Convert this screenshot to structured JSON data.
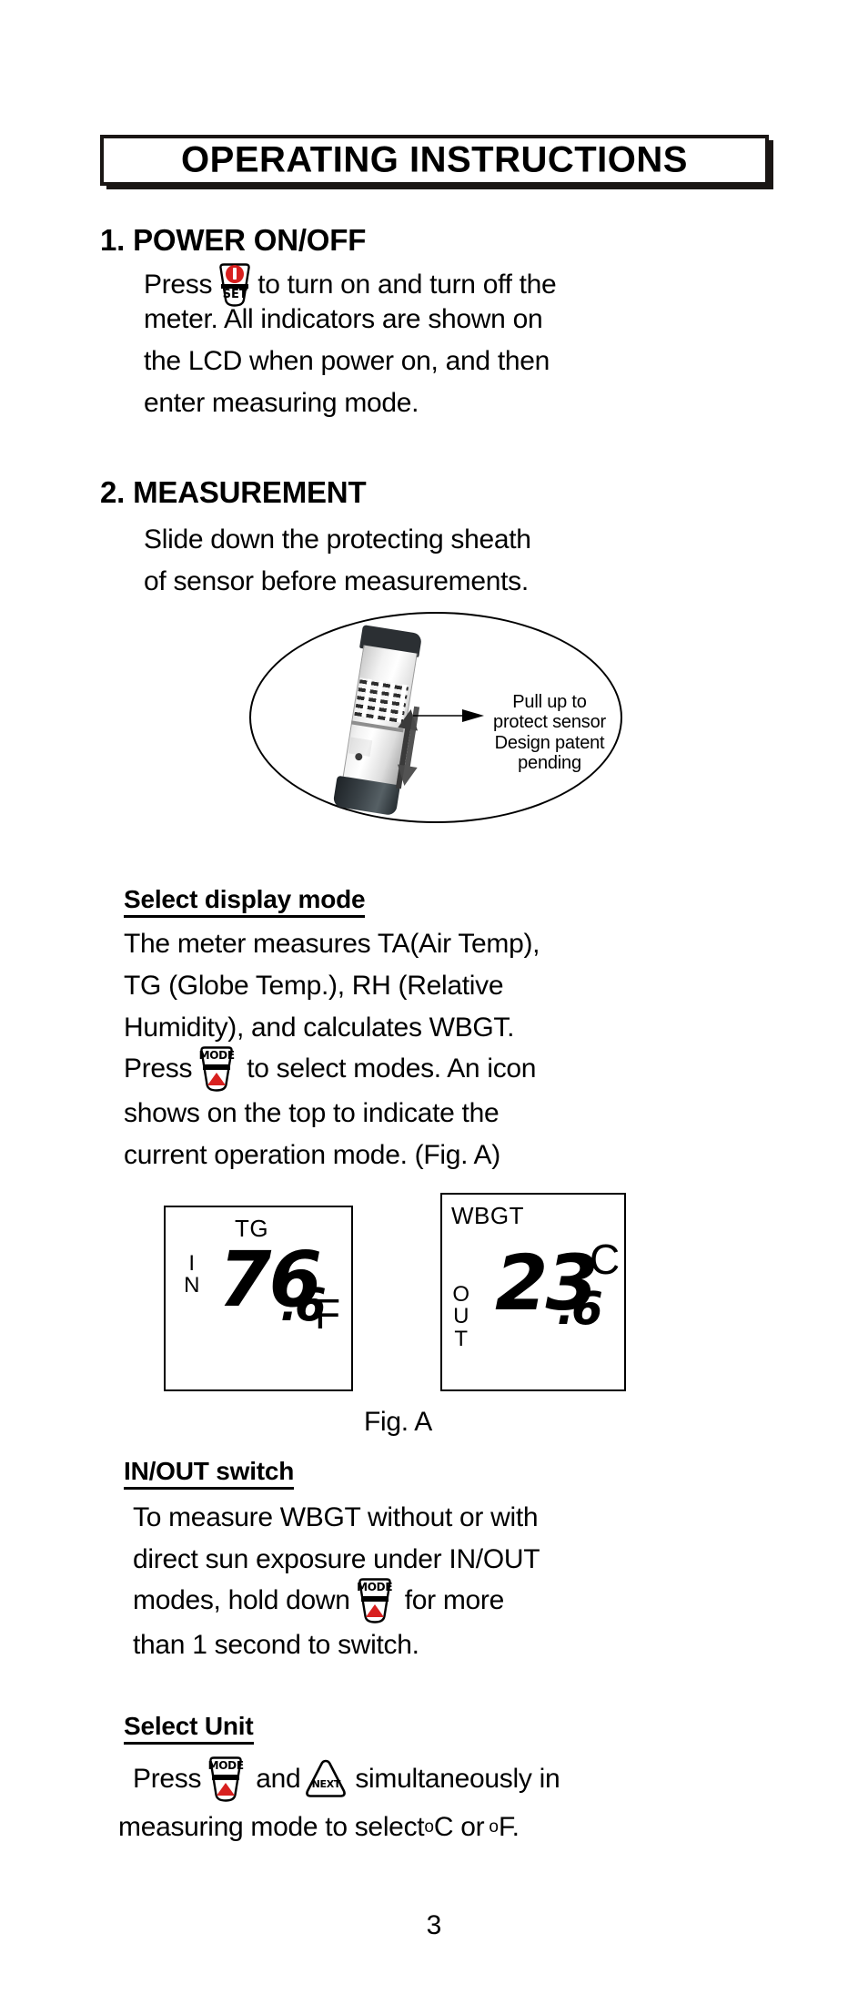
{
  "document": {
    "title": "OPERATING INSTRUCTIONS",
    "page_number": "3"
  },
  "sections": [
    {
      "number": "1.",
      "heading": "1. POWER ON/OFF",
      "lines": [
        "Press",
        "to turn on and turn off the",
        "meter. All indicators are shown on",
        "the LCD when power on, and then",
        "enter measuring mode."
      ]
    },
    {
      "number": "2.",
      "heading": "2. MEASUREMENT",
      "lines": [
        "Slide down the protecting sheath",
        "of sensor before measurements."
      ]
    }
  ],
  "sensor_figure": {
    "callout_lines": [
      "Pull up to",
      "protect sensor",
      "Design patent",
      "pending"
    ]
  },
  "select_display_mode": {
    "heading": "Select display mode",
    "line1": "The meter measures TA(Air Temp),",
    "line2": "TG (Globe Temp.), RH (Relative",
    "line3": "Humidity), and calculates WBGT.",
    "line4_a": "Press",
    "line4_b": "to select modes. An icon",
    "line5": "shows on the top to indicate the",
    "line6": "current operation mode. (Fig. A)"
  },
  "lcd_figures": {
    "caption": "Fig. A",
    "left": {
      "mode_label": "TG",
      "side_label": "IN",
      "whole": "76",
      "decimal": ".6",
      "unit": "F"
    },
    "right": {
      "mode_label": "WBGT",
      "side_label": "OUT",
      "whole": "23",
      "decimal": ".6",
      "unit": "C"
    }
  },
  "in_out_switch": {
    "heading": "IN/OUT switch",
    "line1": "To measure WBGT without or with",
    "line2": "direct sun exposure under IN/OUT",
    "line3_a": "modes, hold down",
    "line3_b": "for more",
    "line4": "than 1 second to switch."
  },
  "select_unit": {
    "heading": "Select Unit",
    "line1_a": "Press",
    "line1_b": "and",
    "line1_c": "simultaneously in",
    "line2_a": "measuring mode to select",
    "line2_deg1": "o",
    "line2_b": "C or",
    "line2_deg2": "o",
    "line2_c": "F."
  },
  "buttons": {
    "set_label": "SET",
    "mode_label": "MODE",
    "next_label": "NEXT"
  },
  "colors": {
    "accent_red": "#d8201f",
    "ink": "#000000",
    "frame": "#1a1614"
  }
}
